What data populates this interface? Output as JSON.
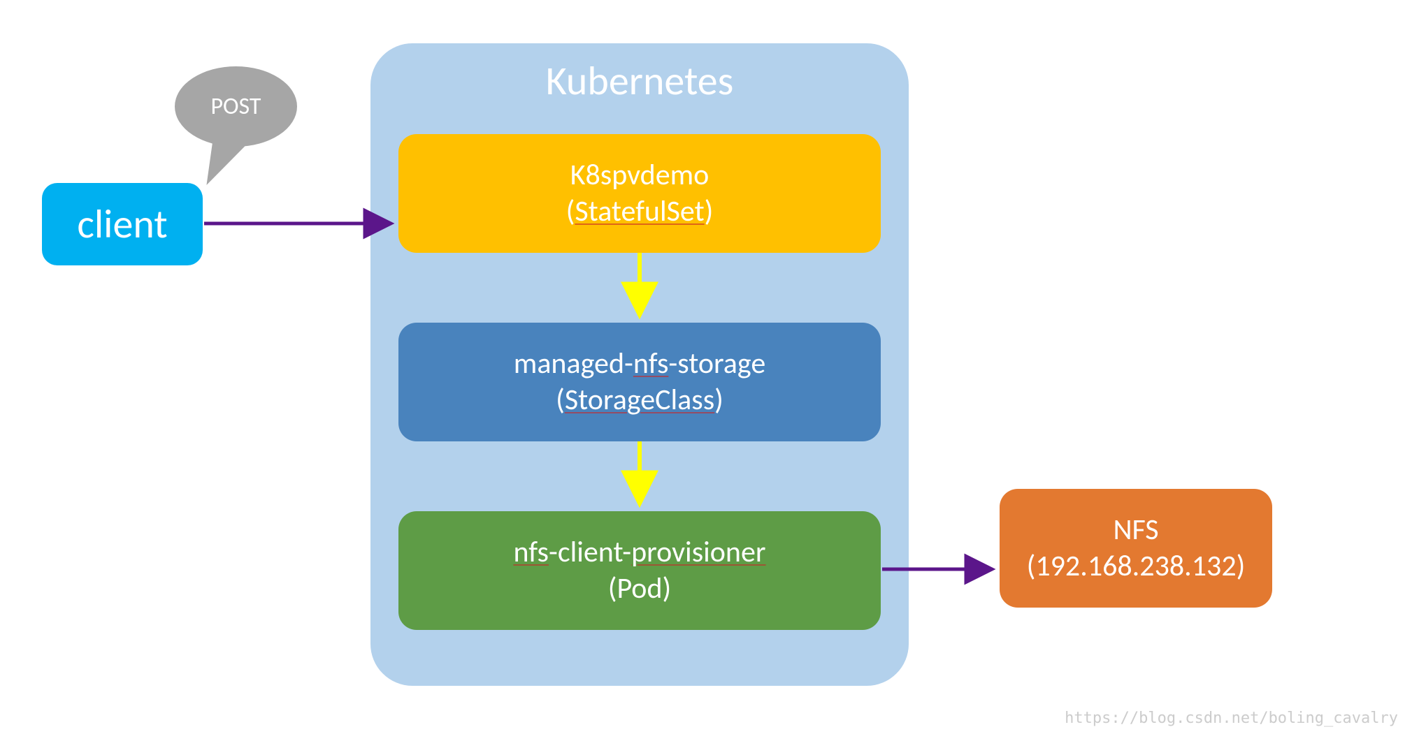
{
  "bubble": {
    "label": "POST"
  },
  "client": {
    "label": "client"
  },
  "kubernetes": {
    "title": "Kubernetes",
    "k8spvdemo": {
      "line1": "K8spvdemo",
      "line2_pre": "(",
      "line2_mid": "StatefulSet",
      "line2_post": ")"
    },
    "nfs_storage": {
      "line1_pre": "managed-",
      "line1_mid": "nfs",
      "line1_post": "-storage",
      "line2_pre": "(",
      "line2_mid": "StorageClass",
      "line2_post": ")"
    },
    "nfs_client": {
      "line1_pre": "nfs",
      "line1_mid1": "-client-",
      "line1_mid2": "provisioner",
      "line2": "(Pod)"
    }
  },
  "nfs_server": {
    "line1": "NFS",
    "line2": "(192.168.238.132)"
  },
  "watermark": "https://blog.csdn.net/boling_cavalry"
}
